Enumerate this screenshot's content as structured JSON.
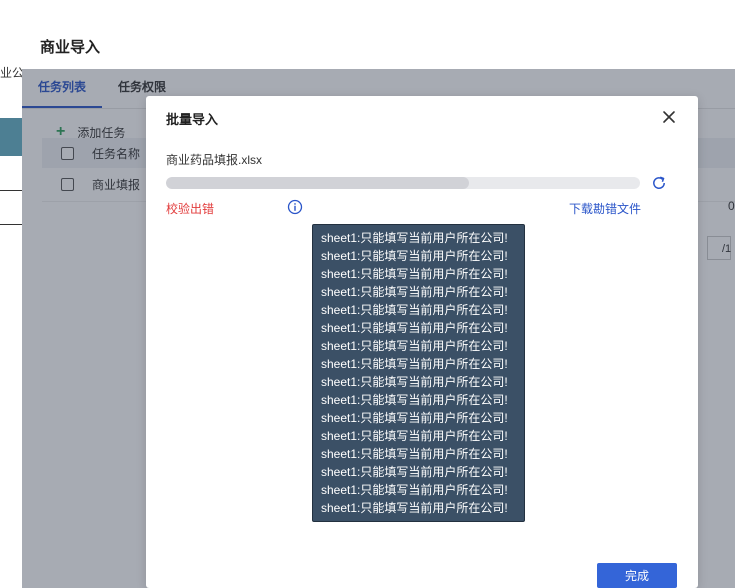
{
  "background_page": {
    "edge_text": "业公司"
  },
  "outer_modal": {
    "title": "商业导入",
    "tabs": [
      {
        "label": "任务列表",
        "active": true
      },
      {
        "label": "任务权限",
        "active": false
      }
    ],
    "toolbar": {
      "add_task_label": "添加任务"
    },
    "table": {
      "header": {
        "task_name": "任务名称"
      },
      "rows": [
        {
          "task_name": "商业填报"
        }
      ]
    },
    "right_digit": "0",
    "pager_text": "/1"
  },
  "dialog": {
    "title": "批量导入",
    "file_name": "商业药品填报.xlsx",
    "progress_percent": 64,
    "status_text": "校验出错",
    "download_link": "下载勘错文件",
    "error_messages": [
      "sheet1:只能填写当前用户所在公司!",
      "sheet1:只能填写当前用户所在公司!",
      "sheet1:只能填写当前用户所在公司!",
      "sheet1:只能填写当前用户所在公司!",
      "sheet1:只能填写当前用户所在公司!",
      "sheet1:只能填写当前用户所在公司!",
      "sheet1:只能填写当前用户所在公司!",
      "sheet1:只能填写当前用户所在公司!",
      "sheet1:只能填写当前用户所在公司!",
      "sheet1:只能填写当前用户所在公司!",
      "sheet1:只能填写当前用户所在公司!",
      "sheet1:只能填写当前用户所在公司!",
      "sheet1:只能填写当前用户所在公司!",
      "sheet1:只能填写当前用户所在公司!",
      "sheet1:只能填写当前用户所在公司!",
      "sheet1:只能填写当前用户所在公司!"
    ],
    "done_button": "完成"
  },
  "colors": {
    "primary": "#2a55c9",
    "button": "#3465d8",
    "error": "#e23c3c",
    "tooltip_bg": "#3b5066"
  }
}
